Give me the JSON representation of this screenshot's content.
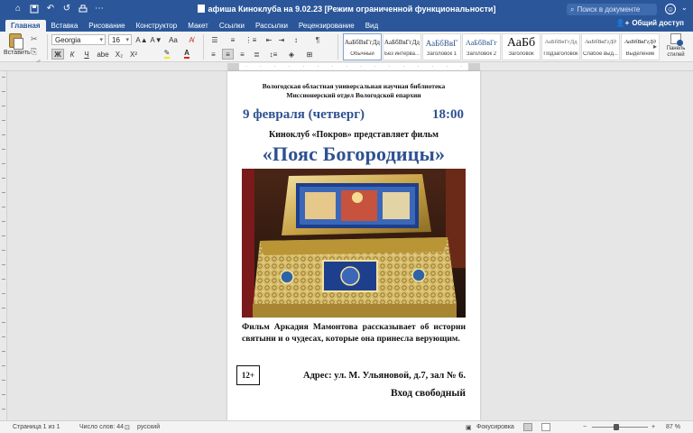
{
  "titlebar": {
    "doc_title": "афиша Киноклуба на 9.02.23 [Режим ограниченной функциональности]",
    "search_placeholder": "Поиск в документе",
    "icons": [
      "home-icon",
      "save-icon",
      "undo-icon",
      "redo-icon",
      "print-icon",
      "customize-icon",
      "document-icon",
      "search-icon",
      "user-icon"
    ]
  },
  "tabs": [
    "Главная",
    "Вставка",
    "Рисование",
    "Конструктор",
    "Макет",
    "Ссылки",
    "Рассылки",
    "Рецензирование",
    "Вид"
  ],
  "active_tab": "Главная",
  "share_label": "Общий доступ",
  "ribbon": {
    "paste_label": "Вставить",
    "font_name": "Georgia",
    "font_size": "16",
    "format_buttons": [
      "Ж",
      "К",
      "Ч",
      "abe",
      "X₂",
      "X²"
    ],
    "grow_font": "A▲",
    "shrink_font": "A▼",
    "change_case": "Aa",
    "highlight_color": "#f5e600",
    "font_color": "#e2231a",
    "pilcrow": "¶",
    "styles": [
      {
        "preview": "АаБбВвГгДд",
        "label": "Обычный"
      },
      {
        "preview": "АаБбВвГгДд",
        "label": "Без интерва..."
      },
      {
        "preview": "АаБбВвГ",
        "label": "Заголовок 1"
      },
      {
        "preview": "АаБбВвГг",
        "label": "Заголовок 2"
      },
      {
        "preview": "АаБб",
        "label": "Заголовок"
      },
      {
        "preview": "АаБбВвГгДд",
        "label": "Подзаголовок"
      },
      {
        "preview": "АаБбВвГгДд",
        "label": "Слабое выд..."
      },
      {
        "preview": "АаБбВвГгДд",
        "label": "Выделение"
      }
    ],
    "panel_label": "Панель стилей"
  },
  "document": {
    "org_line1": "Вологодская областная универсальная научная библиотека",
    "org_line2": "Миссионерский отдел  Вологодской епархии",
    "date": "9 февраля (четверг)",
    "time": "18:00",
    "club_line": "Киноклуб  «Покров» представляет  фильм",
    "film_title": "«Пояс Богородицы»",
    "description": "Фильм Аркадия Мамонтова рассказывает об истории святыни и о чудесах, которые она принесла верующим.",
    "age_rating": "12+",
    "address": "Адрес: ул. М. Ульяновой, д.7, зал № 6.",
    "entry": "Вход свободный",
    "accent_color": "#2e5191"
  },
  "statusbar": {
    "page": "Страница 1 из 1",
    "words": "Число слов: 44",
    "language": "русский",
    "focus": "Фокусировка",
    "zoom": "87 %",
    "zoom_level": 0.87
  }
}
